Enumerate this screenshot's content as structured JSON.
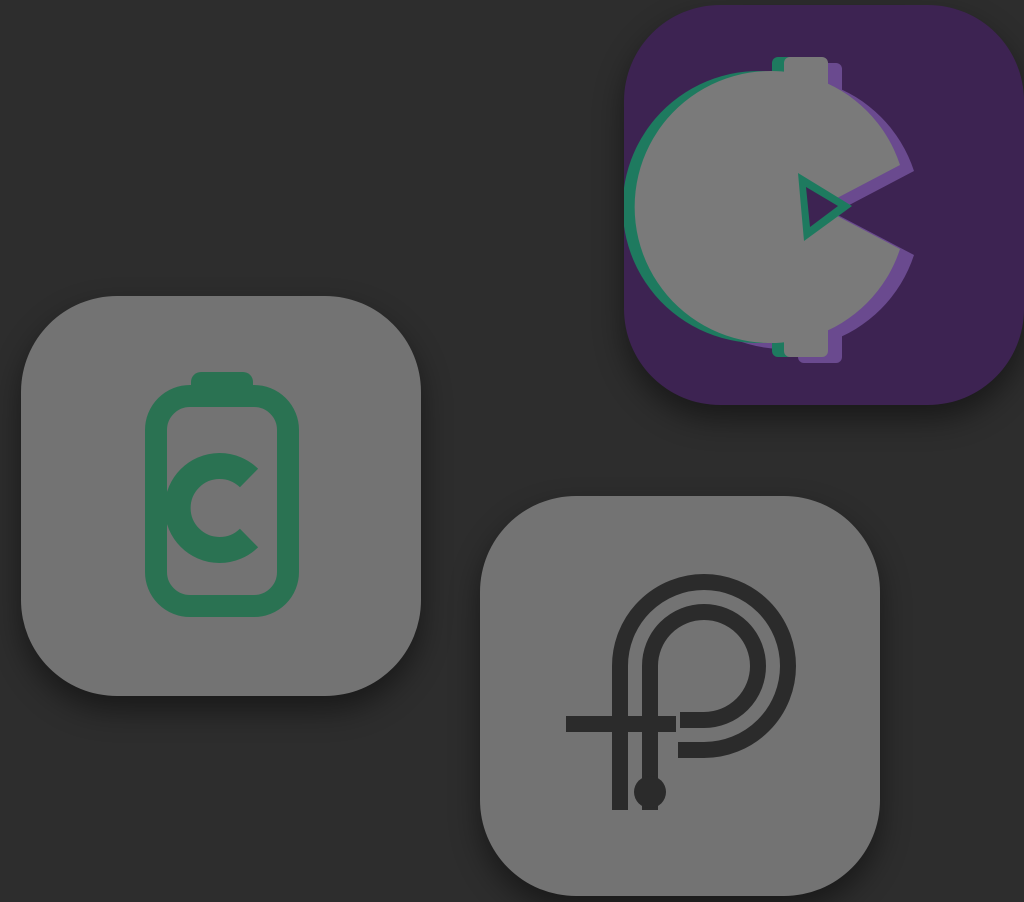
{
  "screen": {
    "background_color": "#2d2d2d"
  },
  "apps": [
    {
      "icon": "cent-play-icon",
      "tile_color": "#3d2352",
      "accent_colors": [
        "#1e7a5f",
        "#6a4a8f",
        "#7a7a7a"
      ]
    },
    {
      "icon": "battery-c-icon",
      "tile_color": "#737373",
      "accent_colors": [
        "#2a7252"
      ]
    },
    {
      "icon": "p-cross-icon",
      "tile_color": "#737373",
      "accent_colors": [
        "#2b2b2b"
      ]
    }
  ]
}
